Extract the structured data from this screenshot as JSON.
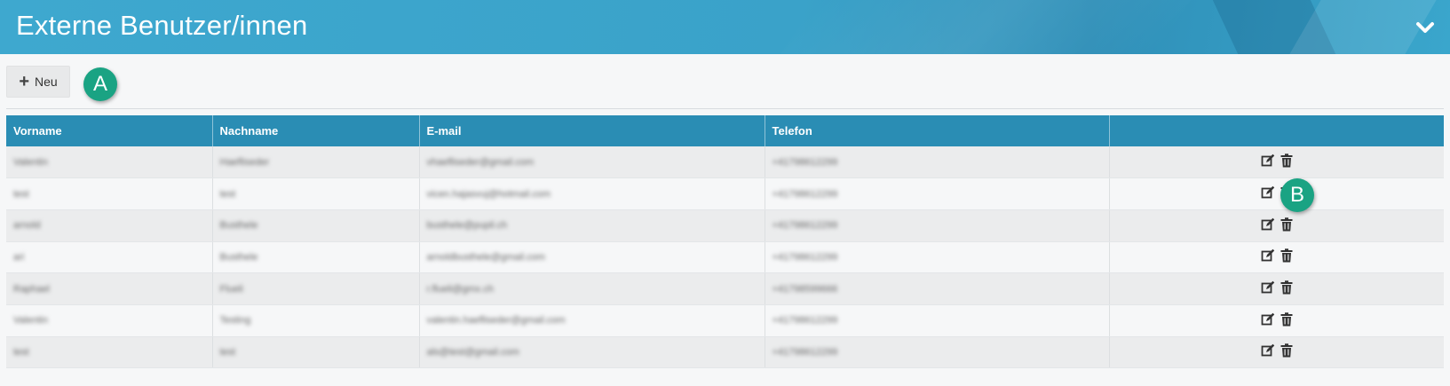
{
  "header": {
    "title": "Externe Benutzer/innen",
    "collapse_icon": "chevron-down-icon"
  },
  "toolbar": {
    "new_label": "Neu",
    "new_icon": "plus-icon"
  },
  "markers": {
    "a": "A",
    "b": "B"
  },
  "table": {
    "columns": [
      "Vorname",
      "Nachname",
      "E-mail",
      "Telefon",
      ""
    ],
    "rows": [
      {
        "vorname": "Valentin",
        "nachname": "Haefliseder",
        "email": "vhaefliseder@gmail.com",
        "telefon": "+41798612299"
      },
      {
        "vorname": "test",
        "nachname": "test",
        "email": "vicen.hajasvuj@hotmail.com",
        "telefon": "+41798612299"
      },
      {
        "vorname": "arnold",
        "nachname": "Busthele",
        "email": "busthele@pupil.ch",
        "telefon": "+41798612299"
      },
      {
        "vorname": "ari",
        "nachname": "Busthele",
        "email": "arnoldbusthele@gmail.com",
        "telefon": "+41798612299"
      },
      {
        "vorname": "Raphael",
        "nachname": "Flueli",
        "email": "r.flueli@gmx.ch",
        "telefon": "+41798599666"
      },
      {
        "vorname": "Valentin",
        "nachname": "Testing",
        "email": "valentin.haefliseder@gmail.com",
        "telefon": "+41798612299"
      },
      {
        "vorname": "test",
        "nachname": "test",
        "email": "als@test@gmail.com",
        "telefon": "+41798612299"
      }
    ],
    "row_action_icons": [
      "edit-icon",
      "trash-icon"
    ]
  },
  "colors": {
    "header_bg": "#3ea8cf",
    "table_header_bg": "#2a8db4",
    "marker_bg": "#1aa383"
  }
}
